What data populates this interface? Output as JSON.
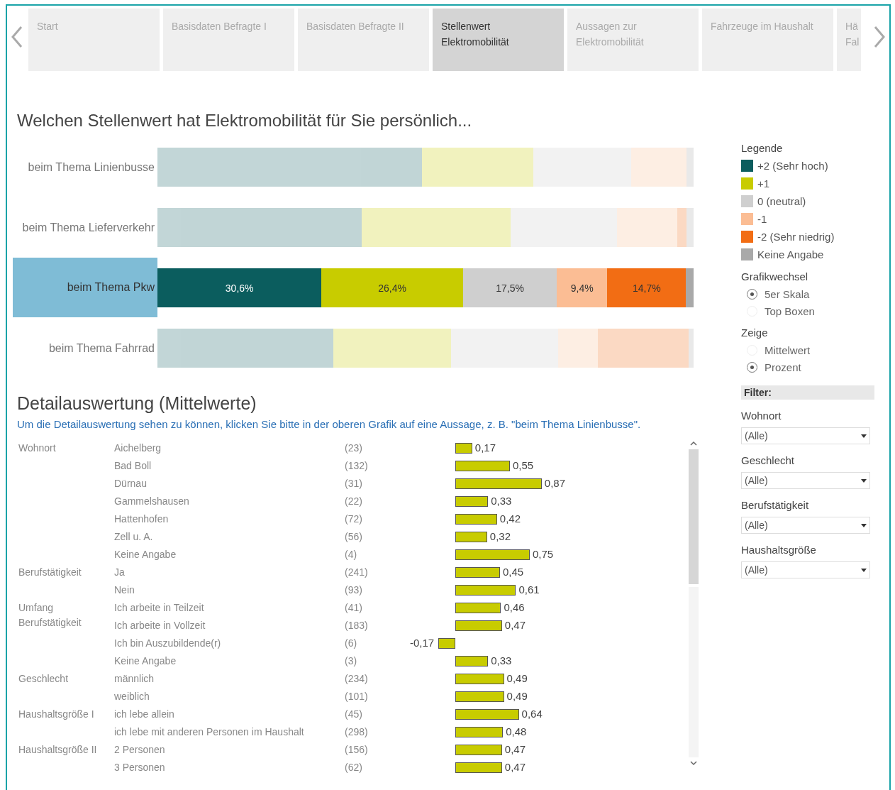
{
  "tabs": [
    {
      "label": "Start",
      "selected": false
    },
    {
      "label": "Basisdaten Befragte I",
      "selected": false
    },
    {
      "label": "Basisdaten Befragte II",
      "selected": false
    },
    {
      "label": "Stellenwert Elektromobilität",
      "selected": true
    },
    {
      "label": "Aussagen zur Elektromobilität",
      "selected": false
    },
    {
      "label": "Fahrzeuge im Haushalt",
      "selected": false
    },
    {
      "label": "Hä Fal",
      "selected": false
    }
  ],
  "title": "Welchen Stellenwert hat Elektromobilität für Sie persönlich...",
  "topics": {
    "selected": [
      false,
      false,
      true,
      false
    ],
    "chart_data": {
      "type": "bar",
      "orientation": "horizontal",
      "stacked": true,
      "categories": [
        "beim Thema Linienbusse",
        "beim Thema Lieferverkehr",
        "beim Thema Pkw",
        "beim Thema Fahrrad"
      ],
      "series": [
        {
          "name": "+2 (Sehr hoch)",
          "color": "#0b5d5e",
          "values": [
            49.3,
            38.1,
            30.6,
            32.8
          ],
          "value_labels": [
            null,
            null,
            "30,6%",
            null
          ]
        },
        {
          "name": "+1",
          "color": "#c8cc00",
          "values": [
            20.8,
            27.8,
            26.4,
            22.0
          ],
          "value_labels": [
            null,
            null,
            "26,4%",
            null
          ]
        },
        {
          "name": "0 (neutral)",
          "color": "#cfcfcf",
          "values": [
            18.3,
            19.8,
            17.5,
            20.0
          ],
          "value_labels": [
            null,
            null,
            "17,5%",
            null
          ]
        },
        {
          "name": "-1",
          "color": "#fbbd94",
          "values": [
            10.3,
            11.2,
            9.4,
            7.3
          ],
          "value_labels": [
            null,
            null,
            "9,4%",
            null
          ]
        },
        {
          "name": "-2 (Sehr niedrig)",
          "color": "#f26d14",
          "values": [
            null,
            1.8,
            14.7,
            17.0
          ],
          "value_labels": [
            null,
            null,
            "14,7%",
            null
          ]
        },
        {
          "name": "Keine Angabe",
          "color": "#a9a9a9",
          "values": [
            1.3,
            1.3,
            1.4,
            0.9
          ]
        }
      ]
    }
  },
  "detail": {
    "title": "Detailauswertung (Mittelwerte)",
    "hint": "Um die Detailauswertung sehen zu können, klicken Sie bitte in der oberen Grafik auf eine Aussage, z. B. \"beim  Thema Linienbusse\".",
    "rows": [
      {
        "group": "Wohnort",
        "count": "(23)"
      },
      {
        "count": "(132)"
      },
      {
        "count": "(31)"
      },
      {
        "count": "(22)"
      },
      {
        "count": "(72)"
      },
      {
        "count": "(56)"
      },
      {
        "count": "(4)"
      },
      {
        "group": "Berufstätigkeit",
        "count": "(241)"
      },
      {
        "count": "(93)"
      },
      {
        "group": "Umfang Berufstätigkeit",
        "count": "(41)"
      },
      {
        "count": "(183)"
      },
      {
        "count": "(6)"
      },
      {
        "count": "(3)"
      },
      {
        "group": "Geschlecht",
        "count": "(234)"
      },
      {
        "count": "(101)"
      },
      {
        "group": "Haushaltsgröße I",
        "count": "(45)"
      },
      {
        "count": "(298)"
      },
      {
        "group": "Haushaltsgröße II",
        "count": "(156)"
      },
      {
        "count": "(62)"
      }
    ],
    "chart_data": {
      "type": "bar",
      "orientation": "horizontal",
      "categories": [
        "Aichelberg",
        "Bad Boll",
        "Dürnau",
        "Gammelshausen",
        "Hattenhofen",
        "Zell u. A.",
        "Keine Angabe",
        "Ja",
        "Nein",
        "Ich arbeite in Teilzeit",
        "Ich arbeite in Vollzeit",
        "Ich bin Auszubildende(r)",
        "Keine Angabe",
        "männlich",
        "weiblich",
        "ich lebe allein",
        "ich lebe mit anderen Personen im Haushalt",
        "2 Personen",
        "3 Personen"
      ],
      "values": [
        0.17,
        0.55,
        0.87,
        0.33,
        0.42,
        0.32,
        0.75,
        0.45,
        0.61,
        0.46,
        0.47,
        -0.17,
        0.33,
        0.49,
        0.49,
        0.64,
        0.48,
        0.47,
        0.47
      ],
      "value_labels": [
        "0,17",
        "0,55",
        "0,87",
        "0,33",
        "0,42",
        "0,32",
        "0,75",
        "0,45",
        "0,61",
        "0,46",
        "0,47",
        "-0,17",
        "0,33",
        "0,49",
        "0,49",
        "0,64",
        "0,48",
        "0,47",
        "0,47"
      ]
    }
  },
  "legend_title": "Legende",
  "radio_groups": [
    {
      "title": "Grafikwechsel",
      "options": [
        {
          "label": "5er Skala",
          "selected": true
        },
        {
          "label": "Top Boxen",
          "selected": false
        }
      ]
    },
    {
      "title": "Zeige",
      "options": [
        {
          "label": "Mittelwert",
          "selected": false
        },
        {
          "label": "Prozent",
          "selected": true
        }
      ]
    }
  ],
  "filter": {
    "title": "Filter:",
    "fields": [
      {
        "label": "Wohnort",
        "value": "(Alle)"
      },
      {
        "label": "Geschlecht",
        "value": "(Alle)"
      },
      {
        "label": "Berufstätigkeit",
        "value": "(Alle)"
      },
      {
        "label": "Haushaltsgröße",
        "value": "(Alle)"
      }
    ]
  }
}
